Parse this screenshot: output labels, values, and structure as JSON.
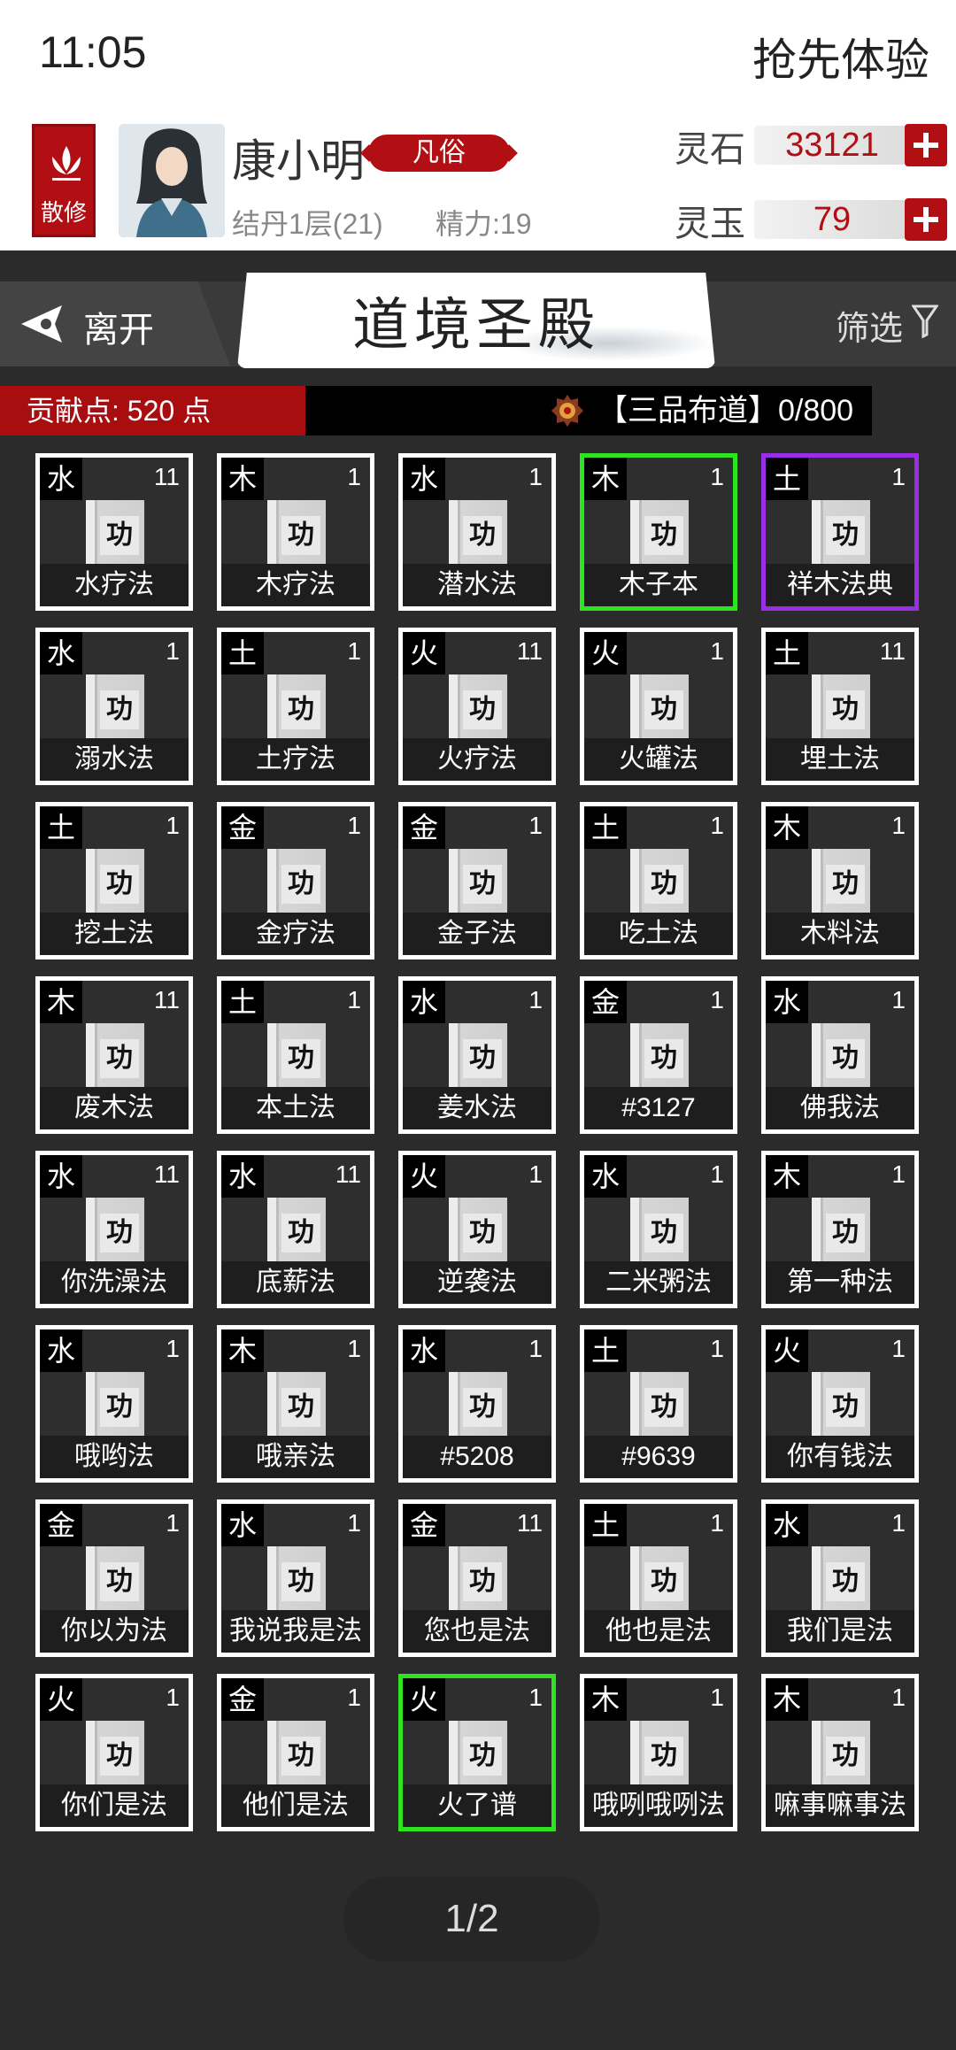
{
  "status": {
    "time": "11:05",
    "trial_label": "抢先体验"
  },
  "player": {
    "sect_label": "散修",
    "name": "康小明",
    "rank_badge": "凡俗",
    "realm": "结丹1层(21)",
    "energy": "精力:19"
  },
  "resources": [
    {
      "label": "灵石",
      "value": "33121"
    },
    {
      "label": "灵玉",
      "value": "79"
    }
  ],
  "header": {
    "leave_label": "离开",
    "title": "道境圣殿",
    "filter_label": "筛选"
  },
  "contribution": {
    "points": "贡献点: 520 点",
    "rank_text": "【三品布道】0/800"
  },
  "book_glyph": "功",
  "cards": [
    {
      "element": "水",
      "count": "11",
      "name": "水疗法",
      "highlight": "none"
    },
    {
      "element": "木",
      "count": "1",
      "name": "木疗法",
      "highlight": "none"
    },
    {
      "element": "水",
      "count": "1",
      "name": "潜水法",
      "highlight": "none"
    },
    {
      "element": "木",
      "count": "1",
      "name": "木子本",
      "highlight": "green"
    },
    {
      "element": "土",
      "count": "1",
      "name": "祥木法典",
      "highlight": "purple"
    },
    {
      "element": "水",
      "count": "1",
      "name": "溺水法",
      "highlight": "none"
    },
    {
      "element": "土",
      "count": "1",
      "name": "土疗法",
      "highlight": "none"
    },
    {
      "element": "火",
      "count": "11",
      "name": "火疗法",
      "highlight": "none"
    },
    {
      "element": "火",
      "count": "1",
      "name": "火罐法",
      "highlight": "none"
    },
    {
      "element": "土",
      "count": "11",
      "name": "埋土法",
      "highlight": "none"
    },
    {
      "element": "土",
      "count": "1",
      "name": "挖土法",
      "highlight": "none"
    },
    {
      "element": "金",
      "count": "1",
      "name": "金疗法",
      "highlight": "none"
    },
    {
      "element": "金",
      "count": "1",
      "name": "金子法",
      "highlight": "none"
    },
    {
      "element": "土",
      "count": "1",
      "name": "吃土法",
      "highlight": "none"
    },
    {
      "element": "木",
      "count": "1",
      "name": "木料法",
      "highlight": "none"
    },
    {
      "element": "木",
      "count": "11",
      "name": "废木法",
      "highlight": "none"
    },
    {
      "element": "土",
      "count": "1",
      "name": "本土法",
      "highlight": "none"
    },
    {
      "element": "水",
      "count": "1",
      "name": "姜水法",
      "highlight": "none"
    },
    {
      "element": "金",
      "count": "1",
      "name": "#3127",
      "highlight": "none"
    },
    {
      "element": "水",
      "count": "1",
      "name": "佛我法",
      "highlight": "none"
    },
    {
      "element": "水",
      "count": "11",
      "name": "你洗澡法",
      "highlight": "none"
    },
    {
      "element": "水",
      "count": "11",
      "name": "底薪法",
      "highlight": "none"
    },
    {
      "element": "火",
      "count": "1",
      "name": "逆袭法",
      "highlight": "none"
    },
    {
      "element": "水",
      "count": "1",
      "name": "二米粥法",
      "highlight": "none"
    },
    {
      "element": "木",
      "count": "1",
      "name": "第一种法",
      "highlight": "none"
    },
    {
      "element": "水",
      "count": "1",
      "name": "哦哟法",
      "highlight": "none"
    },
    {
      "element": "木",
      "count": "1",
      "name": "哦亲法",
      "highlight": "none"
    },
    {
      "element": "水",
      "count": "1",
      "name": "#5208",
      "highlight": "none"
    },
    {
      "element": "土",
      "count": "1",
      "name": "#9639",
      "highlight": "none"
    },
    {
      "element": "火",
      "count": "1",
      "name": "你有钱法",
      "highlight": "none"
    },
    {
      "element": "金",
      "count": "1",
      "name": "你以为法",
      "highlight": "none"
    },
    {
      "element": "水",
      "count": "1",
      "name": "我说我是法",
      "highlight": "none"
    },
    {
      "element": "金",
      "count": "11",
      "name": "您也是法",
      "highlight": "none"
    },
    {
      "element": "土",
      "count": "1",
      "name": "他也是法",
      "highlight": "none"
    },
    {
      "element": "水",
      "count": "1",
      "name": "我们是法",
      "highlight": "none"
    },
    {
      "element": "火",
      "count": "1",
      "name": "你们是法",
      "highlight": "none"
    },
    {
      "element": "金",
      "count": "1",
      "name": "他们是法",
      "highlight": "none"
    },
    {
      "element": "火",
      "count": "1",
      "name": "火了谱",
      "highlight": "green"
    },
    {
      "element": "木",
      "count": "1",
      "name": "哦咧哦咧法",
      "highlight": "none"
    },
    {
      "element": "木",
      "count": "1",
      "name": "嘛事嘛事法",
      "highlight": "none"
    }
  ],
  "pager": {
    "label": "1/2"
  },
  "colors": {
    "accent_red": "#b10f14",
    "highlight_green": "#2ee31f",
    "highlight_purple": "#9a2ee6"
  }
}
